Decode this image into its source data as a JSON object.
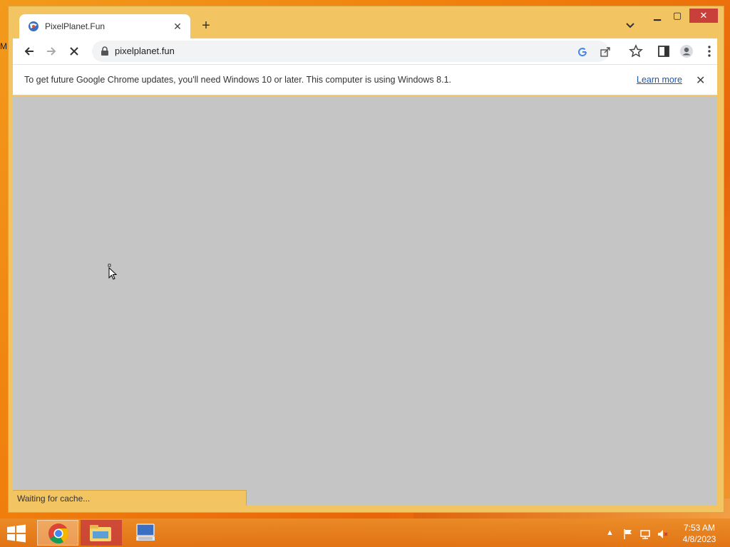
{
  "desktop": {
    "edge_text": "M"
  },
  "browser": {
    "tab": {
      "title": "PixelPlanet.Fun"
    },
    "address": {
      "url": "pixelplanet.fun"
    },
    "infobar": {
      "message": "To get future Google Chrome updates, you'll need Windows 10 or later. This computer is using Windows 8.1.",
      "link": "Learn more"
    },
    "status": "Waiting for cache..."
  },
  "taskbar": {
    "items": [
      "chrome-icon",
      "file-explorer-icon",
      "remote-desktop-icon"
    ],
    "clock": {
      "time": "7:53 AM",
      "date": "4/8/2023"
    }
  },
  "colors": {
    "window_frame": "#f2c462",
    "content_bg": "#c5c5c5",
    "close_button": "#c9403a",
    "link": "#1a57b8"
  }
}
